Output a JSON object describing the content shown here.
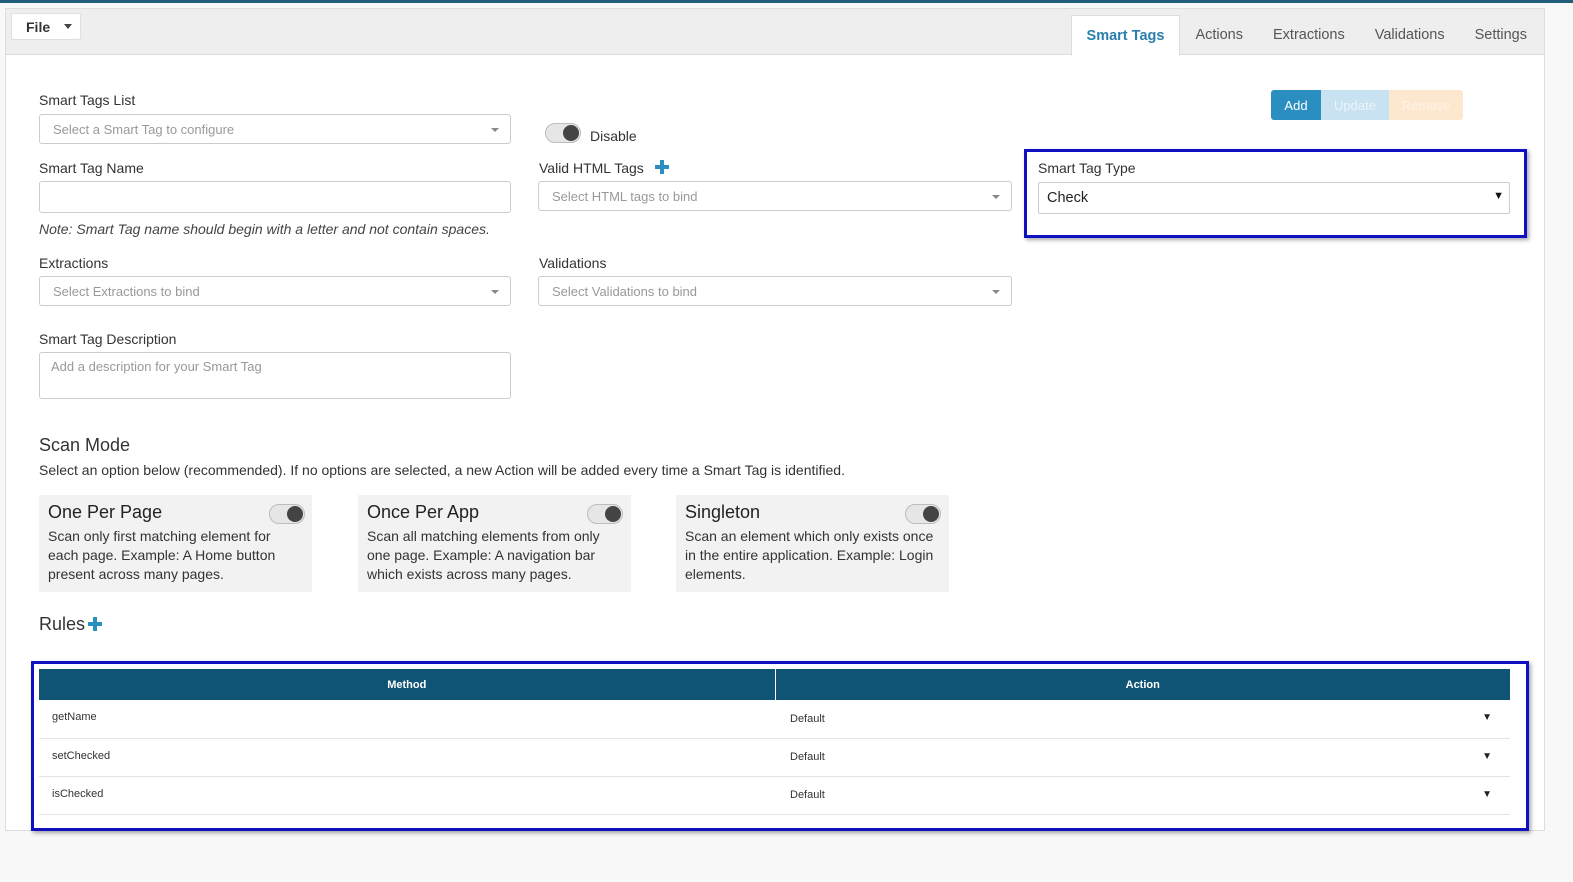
{
  "menu": {
    "file_label": "File"
  },
  "tabs": [
    {
      "label": "Smart Tags",
      "active": true
    },
    {
      "label": "Actions"
    },
    {
      "label": "Extractions"
    },
    {
      "label": "Validations"
    },
    {
      "label": "Settings"
    }
  ],
  "buttons": {
    "add": "Add",
    "update": "Update",
    "remove": "Remove"
  },
  "form": {
    "smart_tags_list": {
      "label": "Smart Tags List",
      "placeholder": "Select a Smart Tag to configure"
    },
    "disable_label": "Disable",
    "smart_tag_name": {
      "label": "Smart Tag Name",
      "value": ""
    },
    "name_note": "Note: Smart Tag name should begin with a letter and not contain spaces.",
    "valid_html_tags": {
      "label": "Valid HTML Tags",
      "placeholder": "Select HTML tags to bind"
    },
    "smart_tag_type": {
      "label": "Smart Tag Type",
      "value": "Check"
    },
    "extractions": {
      "label": "Extractions",
      "placeholder": "Select Extractions to bind"
    },
    "validations": {
      "label": "Validations",
      "placeholder": "Select Validations to bind"
    },
    "description": {
      "label": "Smart Tag Description",
      "placeholder": "Add a description for your Smart Tag"
    }
  },
  "scan_mode": {
    "title": "Scan Mode",
    "description": "Select an option below (recommended). If no options are selected, a new Action will be added every time a Smart Tag is identified.",
    "options": [
      {
        "title": "One Per Page",
        "text": "Scan only first matching element for each page. Example: A Home button present across many pages."
      },
      {
        "title": "Once Per App",
        "text": "Scan all matching elements from only one page. Example: A navigation bar which exists across many pages."
      },
      {
        "title": "Singleton",
        "text": "Scan an element which only exists once in the entire application. Example: Login elements."
      }
    ]
  },
  "rules": {
    "title": "Rules",
    "columns": {
      "method": "Method",
      "action": "Action"
    },
    "rows": [
      {
        "method": "getName",
        "action": "Default"
      },
      {
        "method": "setChecked",
        "action": "Default"
      },
      {
        "method": "isChecked",
        "action": "Default"
      }
    ]
  },
  "colors": {
    "accent": "#2a8fc0",
    "table_header": "#0f5474",
    "highlight": "#1010c0"
  }
}
